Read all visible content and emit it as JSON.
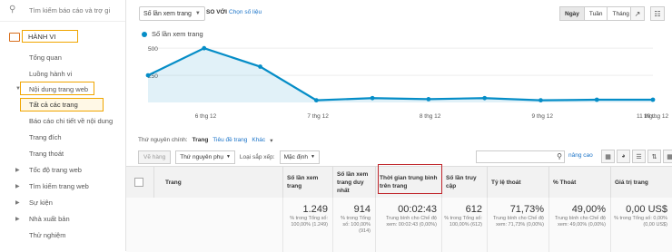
{
  "sidebar": {
    "search_placeholder": "Tìm kiếm báo cáo và trợ gi",
    "section_label": "HÀNH VI",
    "items": [
      {
        "label": "Tổng quan"
      },
      {
        "label": "Luồng hành vi"
      },
      {
        "label": "Nội dung trang web"
      },
      {
        "label": "Tất cả các trang"
      },
      {
        "label": "Báo cáo chi tiết về nội dung"
      },
      {
        "label": "Trang đích"
      },
      {
        "label": "Trang thoát"
      },
      {
        "label": "Tốc độ trang web"
      },
      {
        "label": "Tìm kiếm trang web"
      },
      {
        "label": "Sự kiện"
      },
      {
        "label": "Nhà xuất bản"
      },
      {
        "label": "Thử nghiệm"
      }
    ]
  },
  "toolbar": {
    "metric_select": "Số lần xem trang",
    "vs_label": "SO VỚI",
    "pick_metric": "Chọn số liệu",
    "periods": [
      "Ngày",
      "Tuần",
      "Tháng"
    ],
    "active_period": "Ngày"
  },
  "chart_data": {
    "type": "line",
    "series": [
      {
        "name": "Số lần xem trang",
        "values": [
          250,
          500,
          330,
          20,
          40,
          30,
          40,
          20,
          25,
          25
        ]
      }
    ],
    "y_ticks": [
      "500",
      "250"
    ],
    "x_tick_labels": [
      "6 thg 12",
      "7 thg 12",
      "8 thg 12",
      "9 thg 12",
      "10 thg 12",
      "11 thg..."
    ],
    "ylim": [
      0,
      560
    ],
    "color": "#058dc7",
    "grid": true
  },
  "dimensions": {
    "label": "Thứ nguyên chính:",
    "primary": "Trang",
    "alt": "Tiêu đề trang",
    "other": "Khác"
  },
  "filters": {
    "plot_btn": "Vẽ hàng",
    "secondary": "Thứ nguyên phụ",
    "sort_label": "Loại sắp xếp:",
    "sort_value": "Mặc định",
    "advanced": "nâng cao"
  },
  "table": {
    "headers": [
      "Trang",
      "Số lần xem trang",
      "Số lần xem trang duy nhất",
      "Thời gian trung bình trên trang",
      "Số lần truy cập",
      "Tỷ lệ thoát",
      "% Thoát",
      "Giá trị trang"
    ],
    "totals": [
      {
        "value": "1.249",
        "sub": "% trong Tổng số: 100,00% (1.249)"
      },
      {
        "value": "914",
        "sub": "% trong Tổng số: 100,00% (914)"
      },
      {
        "value": "00:02:43",
        "sub": "Trung bình cho Chế độ xem: 00:02:43 (0,00%)"
      },
      {
        "value": "612",
        "sub": "% trong Tổng số: 100,00% (612)"
      },
      {
        "value": "71,73%",
        "sub": "Trung bình cho Chế độ xem: 71,73% (0,00%)"
      },
      {
        "value": "49,00%",
        "sub": "Trung bình cho Chế độ xem: 49,00% (0,00%)"
      },
      {
        "value": "0,00 US$",
        "sub": "% trong Tổng số: 0,00% (0,00 US$)"
      }
    ]
  }
}
